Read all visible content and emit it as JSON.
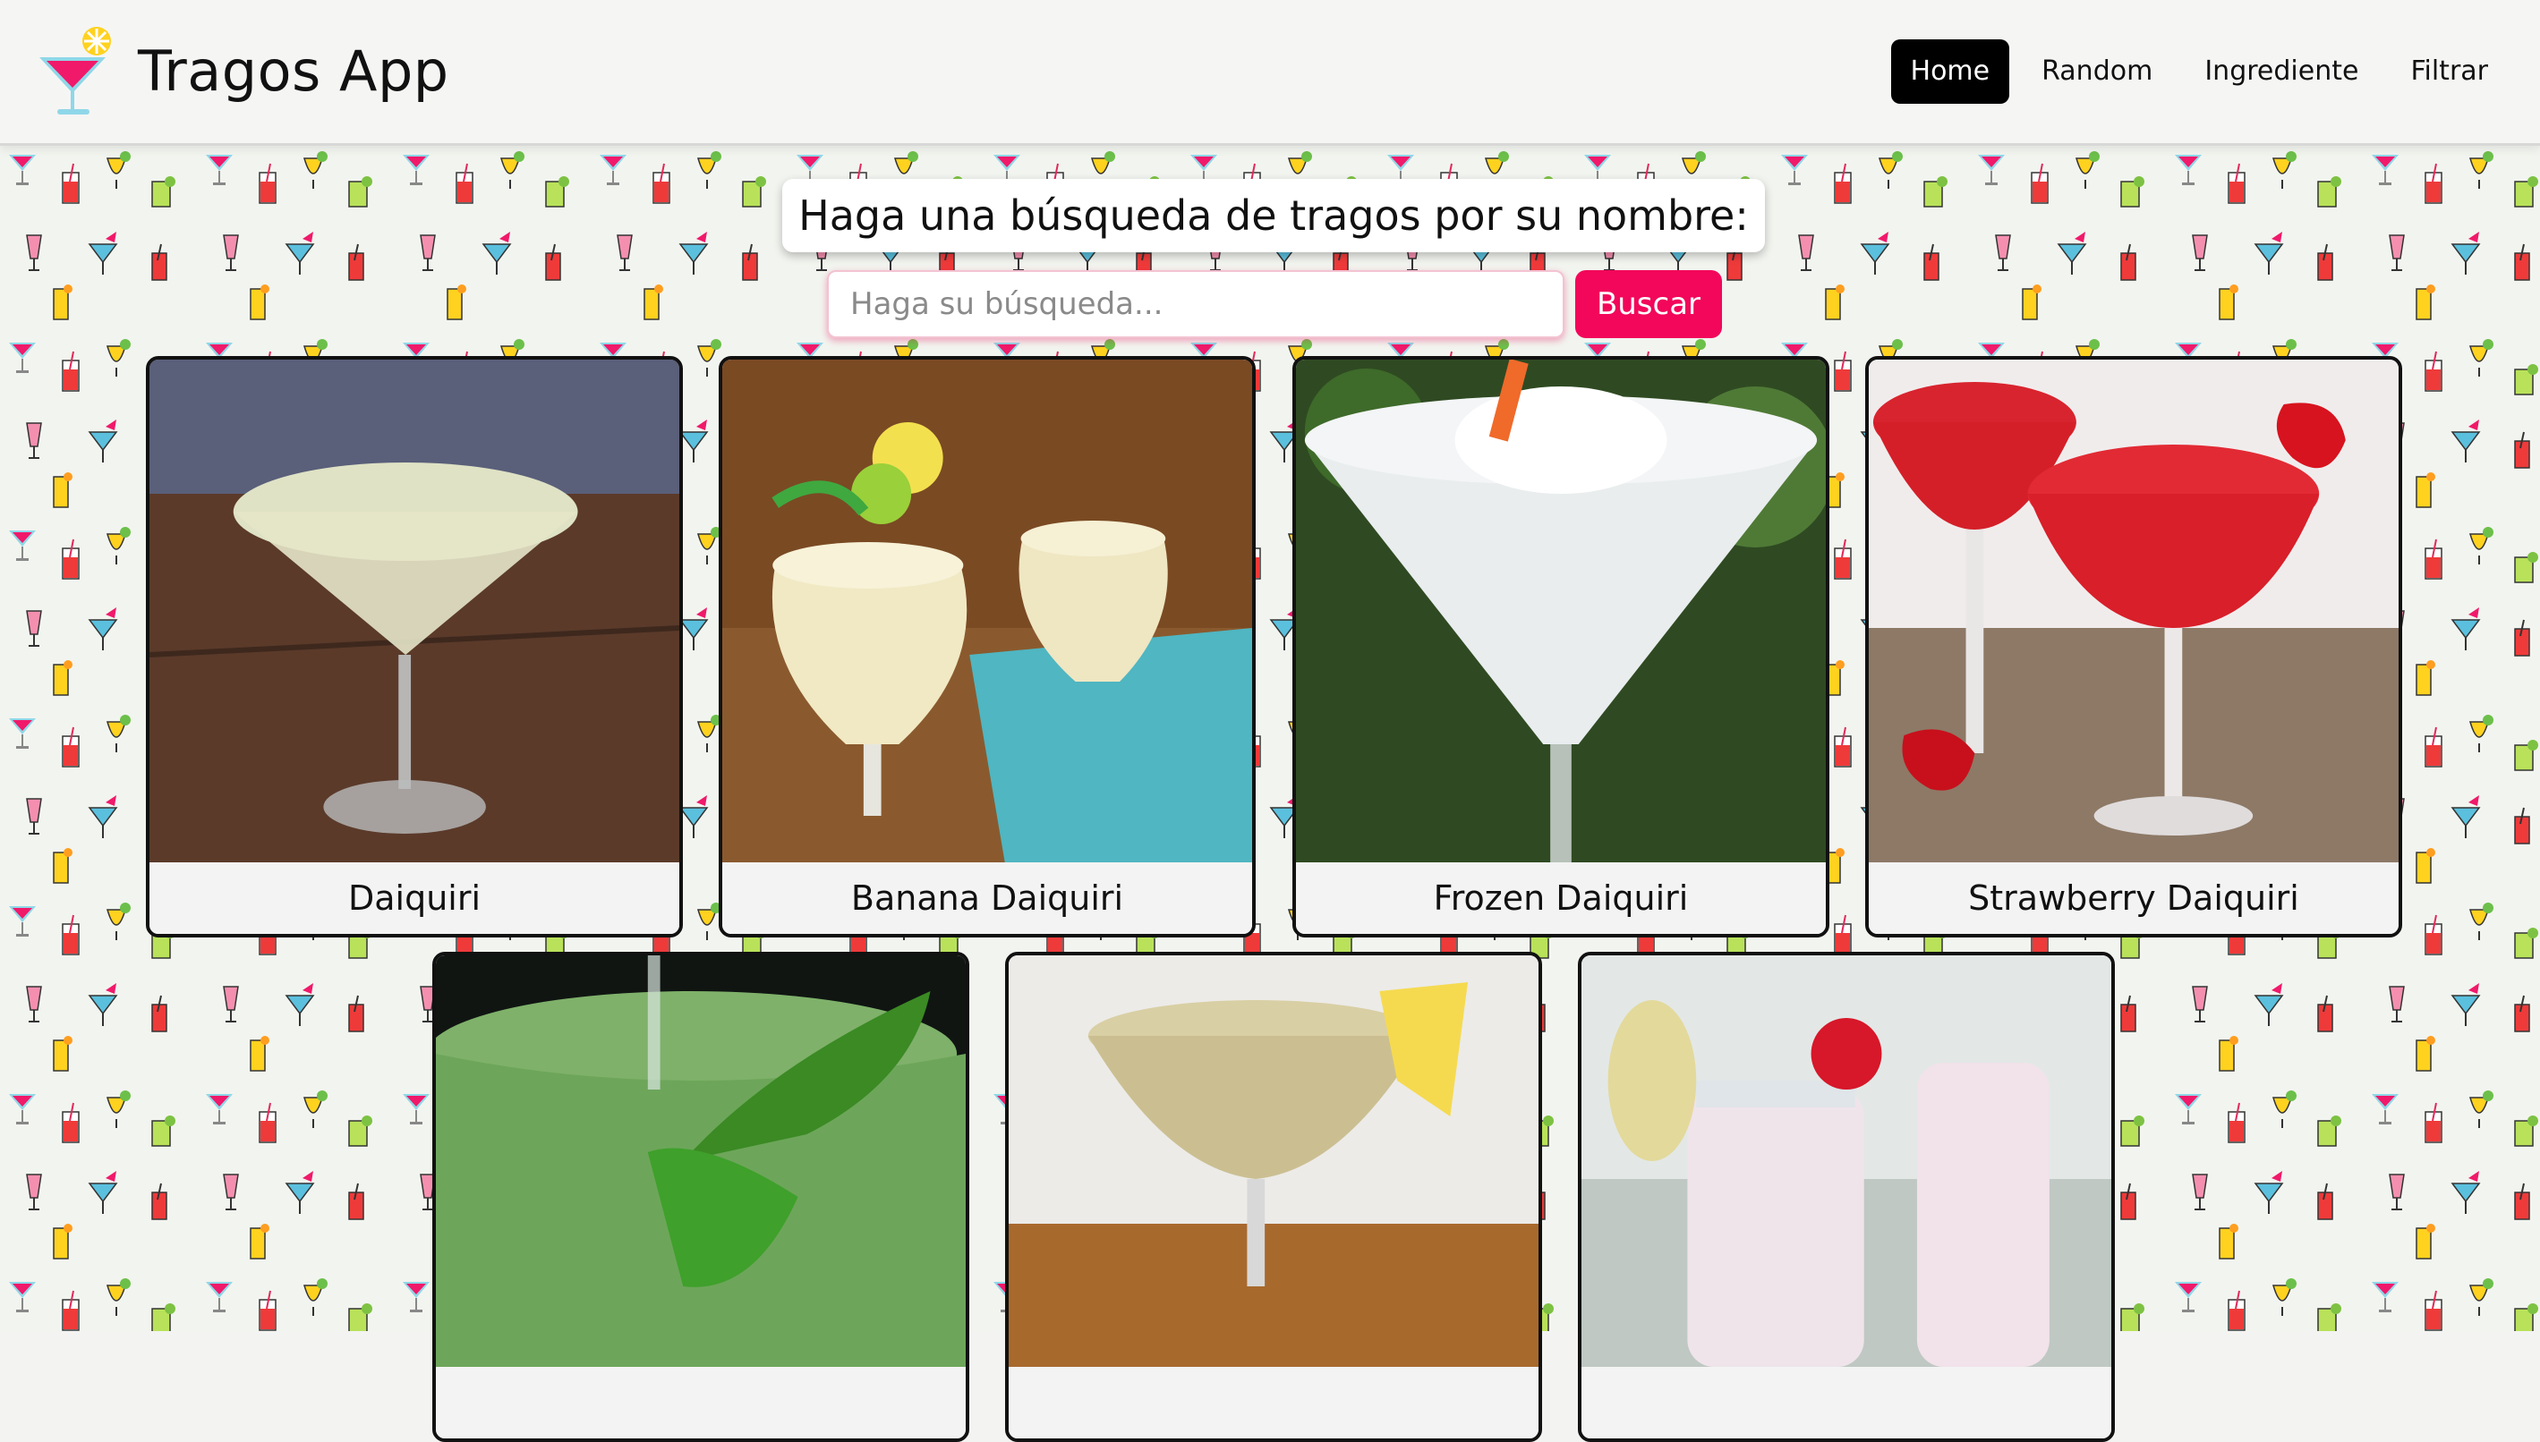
{
  "navbar": {
    "brand": "Tragos App",
    "brand_icon": "cocktail-glass-icon",
    "links": [
      {
        "label": "Home",
        "active": true
      },
      {
        "label": "Random",
        "active": false
      },
      {
        "label": "Ingrediente",
        "active": false
      },
      {
        "label": "Filtrar",
        "active": false
      }
    ]
  },
  "search": {
    "title": "Haga una búsqueda de tragos por su nombre:",
    "placeholder": "Haga su búsqueda...",
    "button_label": "Buscar"
  },
  "drinks": [
    {
      "name": "Daiquiri"
    },
    {
      "name": "Banana Daiquiri"
    },
    {
      "name": "Frozen Daiquiri"
    },
    {
      "name": "Strawberry Daiquiri"
    },
    {
      "name": ""
    },
    {
      "name": ""
    },
    {
      "name": ""
    }
  ],
  "colors": {
    "accent": "#f2075a",
    "nav_active_bg": "#000000",
    "pattern_bg": "#f2f4ef"
  }
}
